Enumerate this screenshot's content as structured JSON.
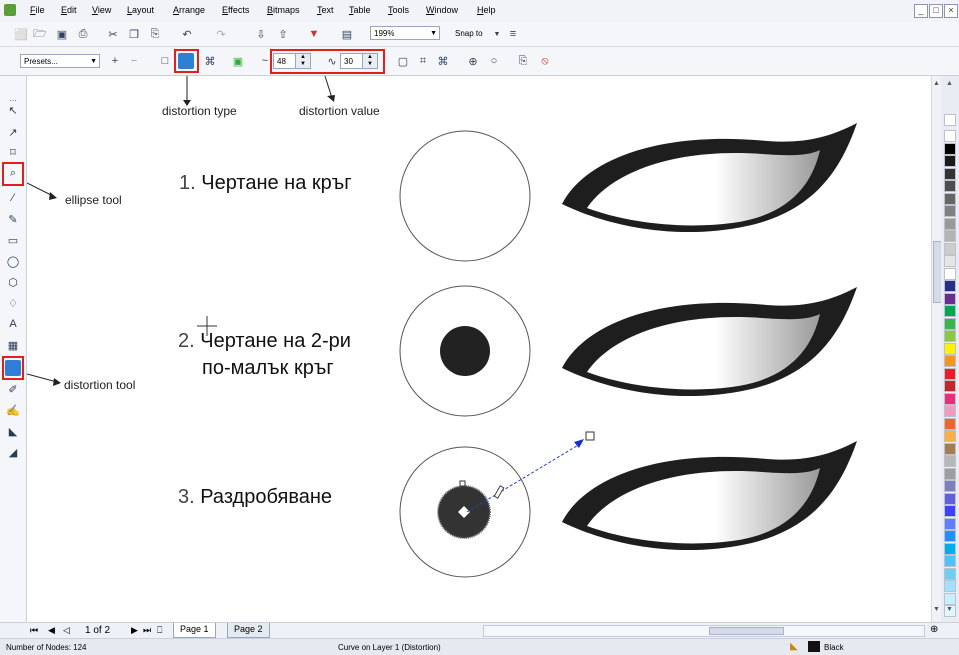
{
  "menu": {
    "items": [
      "File",
      "Edit",
      "View",
      "Layout",
      "Arrange",
      "Effects",
      "Bitmaps",
      "Text",
      "Table",
      "Tools",
      "Window",
      "Help"
    ],
    "window_buttons": [
      "_",
      "□",
      "×"
    ]
  },
  "standard_toolbar": {
    "zoom": "199%",
    "snap_to": "Snap to"
  },
  "property_bar": {
    "presets": "Presets...",
    "distortion_amplitude": "48",
    "distortion_frequency": "30"
  },
  "annotations": {
    "distortion_type": "distortion type",
    "distortion_value": "distortion value",
    "ellipse_tool": "ellipse tool",
    "distortion_tool": "distortion tool"
  },
  "steps": [
    {
      "num": "1.",
      "text": "Чертане на кръг"
    },
    {
      "num": "2.",
      "text": "Чертане на 2-ри",
      "text2": "по-малък кръг"
    },
    {
      "num": "3.",
      "text": "Раздробяване"
    }
  ],
  "page_nav": {
    "counter": "1 of 2",
    "tabs": [
      "Page 1",
      "Page 2"
    ]
  },
  "status": {
    "nodes": "Number of Nodes: 124",
    "object": "Curve on Layer 1  (Distortion)",
    "fill": "Black"
  },
  "palette": [
    "#ffffff",
    "#000000",
    "#1a1a1a",
    "#333333",
    "#4d4d4d",
    "#666666",
    "#808080",
    "#999999",
    "#b3b3b3",
    "#cccccc",
    "#e6e6e6",
    "#ffffff",
    "#2b2b8c",
    "#6a2c91",
    "#00a651",
    "#39b54a",
    "#8dc63f",
    "#fff200",
    "#f7941d",
    "#ed1c24",
    "#c1272d",
    "#ee2a7b",
    "#f49ac1",
    "#f26522",
    "#fbb040",
    "#a67c52",
    "#b7b7b7",
    "#9e9e9e",
    "#7f7fbf",
    "#5f5fdf",
    "#3f3fff",
    "#5f7fff",
    "#1e90ff",
    "#00aeef",
    "#4fc3f7",
    "#6dcff6",
    "#a3e0ff",
    "#c8eeff",
    "#dff6ff"
  ],
  "icons": {
    "distortion_tool": "distortion-icon",
    "ellipse_tool": "ellipse-icon"
  }
}
